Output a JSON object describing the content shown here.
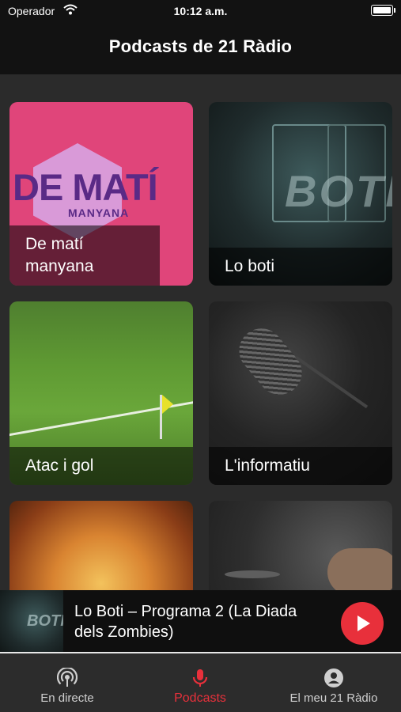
{
  "status_bar": {
    "carrier": "Operador",
    "time": "10:12 a.m."
  },
  "header": {
    "title": "Podcasts de 21 Ràdio"
  },
  "podcasts": [
    {
      "title": "De matí manyana",
      "art_text": "DE MATÍ",
      "art_subtext": "MANYANA"
    },
    {
      "title": "Lo boti",
      "art_text": "BOTI"
    },
    {
      "title": "Atac i gol"
    },
    {
      "title": "L'informatiu"
    },
    {
      "title": ""
    },
    {
      "title": ""
    }
  ],
  "player": {
    "title": "Lo Boti – Programa 2 (La Diada dels Zombies)",
    "thumb_text": "BOTI"
  },
  "tabs": [
    {
      "label": "En directe",
      "icon": "broadcast-icon",
      "active": false
    },
    {
      "label": "Podcasts",
      "icon": "microphone-icon",
      "active": true
    },
    {
      "label": "El meu 21 Ràdio",
      "icon": "account-icon",
      "active": false
    }
  ],
  "colors": {
    "accent": "#e8303b",
    "background": "#2b2b2b",
    "bar": "#121212"
  }
}
